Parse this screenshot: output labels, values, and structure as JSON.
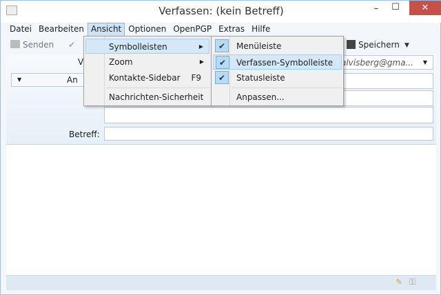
{
  "window": {
    "title": "Verfassen: (kein Betreff)",
    "minimize": "–",
    "maximize": "☐",
    "close": "✕"
  },
  "menubar": [
    "Datei",
    "Bearbeiten",
    "Ansicht",
    "Optionen",
    "OpenPGP",
    "Extras",
    "Hilfe"
  ],
  "toolbar": {
    "send": "Senden",
    "save": "Speichern"
  },
  "header": {
    "from_label": "Von:",
    "from_value": "salvisberg@gma...",
    "to_type": "An",
    "subject_label": "Betreff:",
    "subject_value": ""
  },
  "view_menu": [
    {
      "label": "Symbolleisten",
      "submenu": true
    },
    {
      "label": "Zoom",
      "submenu": true
    },
    {
      "label": "Kontakte-Sidebar",
      "shortcut": "F9"
    },
    {
      "label": "Nachrichten-Sicherheit"
    }
  ],
  "toolbars_submenu": [
    {
      "label": "Menüleiste",
      "checked": true
    },
    {
      "label": "Verfassen-Symbolleiste",
      "checked": true
    },
    {
      "label": "Statusleiste",
      "checked": true
    },
    {
      "label": "Anpassen..."
    }
  ],
  "icons": {
    "check": "✔",
    "submenu": "▶",
    "dropdown": "▼"
  }
}
